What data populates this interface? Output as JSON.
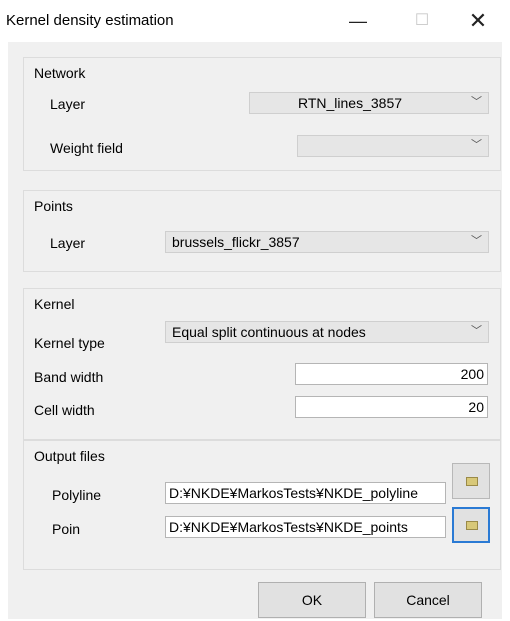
{
  "window": {
    "title": "Kernel density estimation",
    "minimize_icon": "—",
    "maximize_icon": "☐",
    "close_icon": "✕"
  },
  "network": {
    "title": "Network",
    "layer_label": "Layer",
    "layer_value": "RTN_lines_3857",
    "weight_label": "Weight field",
    "weight_value": ""
  },
  "points": {
    "title": "Points",
    "layer_label": "Layer",
    "layer_value": "brussels_flickr_3857"
  },
  "kernel": {
    "title": "Kernel",
    "type_label": "Kernel type",
    "type_value": "Equal split continuous at nodes",
    "band_label": "Band width",
    "band_value": "200",
    "cell_label": "Cell width",
    "cell_value": "20"
  },
  "output": {
    "title": "Output files",
    "polyline_label": "Polyline",
    "polyline_value": "D:¥NKDE¥MarkosTests¥NKDE_polyline",
    "point_label": "Poin",
    "point_value": "D:¥NKDE¥MarkosTests¥NKDE_points"
  },
  "buttons": {
    "ok": "OK",
    "cancel": "Cancel"
  },
  "icons": {
    "dropdown": "chevron-down-icon",
    "browse": "folder-icon"
  }
}
